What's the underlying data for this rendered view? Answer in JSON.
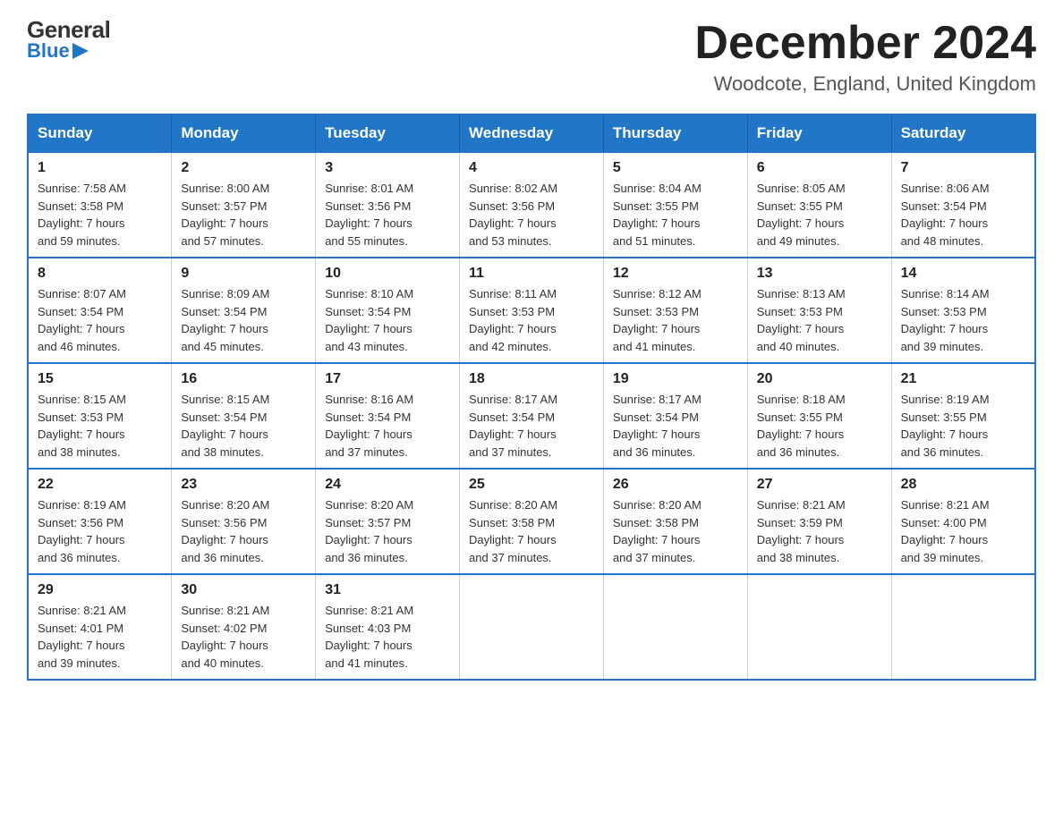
{
  "header": {
    "logo_general": "General",
    "logo_blue": "Blue",
    "main_title": "December 2024",
    "subtitle": "Woodcote, England, United Kingdom"
  },
  "calendar": {
    "days_of_week": [
      "Sunday",
      "Monday",
      "Tuesday",
      "Wednesday",
      "Thursday",
      "Friday",
      "Saturday"
    ],
    "weeks": [
      [
        {
          "day": "1",
          "sunrise": "7:58 AM",
          "sunset": "3:58 PM",
          "daylight": "7 hours and 59 minutes."
        },
        {
          "day": "2",
          "sunrise": "8:00 AM",
          "sunset": "3:57 PM",
          "daylight": "7 hours and 57 minutes."
        },
        {
          "day": "3",
          "sunrise": "8:01 AM",
          "sunset": "3:56 PM",
          "daylight": "7 hours and 55 minutes."
        },
        {
          "day": "4",
          "sunrise": "8:02 AM",
          "sunset": "3:56 PM",
          "daylight": "7 hours and 53 minutes."
        },
        {
          "day": "5",
          "sunrise": "8:04 AM",
          "sunset": "3:55 PM",
          "daylight": "7 hours and 51 minutes."
        },
        {
          "day": "6",
          "sunrise": "8:05 AM",
          "sunset": "3:55 PM",
          "daylight": "7 hours and 49 minutes."
        },
        {
          "day": "7",
          "sunrise": "8:06 AM",
          "sunset": "3:54 PM",
          "daylight": "7 hours and 48 minutes."
        }
      ],
      [
        {
          "day": "8",
          "sunrise": "8:07 AM",
          "sunset": "3:54 PM",
          "daylight": "7 hours and 46 minutes."
        },
        {
          "day": "9",
          "sunrise": "8:09 AM",
          "sunset": "3:54 PM",
          "daylight": "7 hours and 45 minutes."
        },
        {
          "day": "10",
          "sunrise": "8:10 AM",
          "sunset": "3:54 PM",
          "daylight": "7 hours and 43 minutes."
        },
        {
          "day": "11",
          "sunrise": "8:11 AM",
          "sunset": "3:53 PM",
          "daylight": "7 hours and 42 minutes."
        },
        {
          "day": "12",
          "sunrise": "8:12 AM",
          "sunset": "3:53 PM",
          "daylight": "7 hours and 41 minutes."
        },
        {
          "day": "13",
          "sunrise": "8:13 AM",
          "sunset": "3:53 PM",
          "daylight": "7 hours and 40 minutes."
        },
        {
          "day": "14",
          "sunrise": "8:14 AM",
          "sunset": "3:53 PM",
          "daylight": "7 hours and 39 minutes."
        }
      ],
      [
        {
          "day": "15",
          "sunrise": "8:15 AM",
          "sunset": "3:53 PM",
          "daylight": "7 hours and 38 minutes."
        },
        {
          "day": "16",
          "sunrise": "8:15 AM",
          "sunset": "3:54 PM",
          "daylight": "7 hours and 38 minutes."
        },
        {
          "day": "17",
          "sunrise": "8:16 AM",
          "sunset": "3:54 PM",
          "daylight": "7 hours and 37 minutes."
        },
        {
          "day": "18",
          "sunrise": "8:17 AM",
          "sunset": "3:54 PM",
          "daylight": "7 hours and 37 minutes."
        },
        {
          "day": "19",
          "sunrise": "8:17 AM",
          "sunset": "3:54 PM",
          "daylight": "7 hours and 36 minutes."
        },
        {
          "day": "20",
          "sunrise": "8:18 AM",
          "sunset": "3:55 PM",
          "daylight": "7 hours and 36 minutes."
        },
        {
          "day": "21",
          "sunrise": "8:19 AM",
          "sunset": "3:55 PM",
          "daylight": "7 hours and 36 minutes."
        }
      ],
      [
        {
          "day": "22",
          "sunrise": "8:19 AM",
          "sunset": "3:56 PM",
          "daylight": "7 hours and 36 minutes."
        },
        {
          "day": "23",
          "sunrise": "8:20 AM",
          "sunset": "3:56 PM",
          "daylight": "7 hours and 36 minutes."
        },
        {
          "day": "24",
          "sunrise": "8:20 AM",
          "sunset": "3:57 PM",
          "daylight": "7 hours and 36 minutes."
        },
        {
          "day": "25",
          "sunrise": "8:20 AM",
          "sunset": "3:58 PM",
          "daylight": "7 hours and 37 minutes."
        },
        {
          "day": "26",
          "sunrise": "8:20 AM",
          "sunset": "3:58 PM",
          "daylight": "7 hours and 37 minutes."
        },
        {
          "day": "27",
          "sunrise": "8:21 AM",
          "sunset": "3:59 PM",
          "daylight": "7 hours and 38 minutes."
        },
        {
          "day": "28",
          "sunrise": "8:21 AM",
          "sunset": "4:00 PM",
          "daylight": "7 hours and 39 minutes."
        }
      ],
      [
        {
          "day": "29",
          "sunrise": "8:21 AM",
          "sunset": "4:01 PM",
          "daylight": "7 hours and 39 minutes."
        },
        {
          "day": "30",
          "sunrise": "8:21 AM",
          "sunset": "4:02 PM",
          "daylight": "7 hours and 40 minutes."
        },
        {
          "day": "31",
          "sunrise": "8:21 AM",
          "sunset": "4:03 PM",
          "daylight": "7 hours and 41 minutes."
        },
        null,
        null,
        null,
        null
      ]
    ],
    "labels": {
      "sunrise": "Sunrise:",
      "sunset": "Sunset:",
      "daylight": "Daylight:"
    }
  }
}
